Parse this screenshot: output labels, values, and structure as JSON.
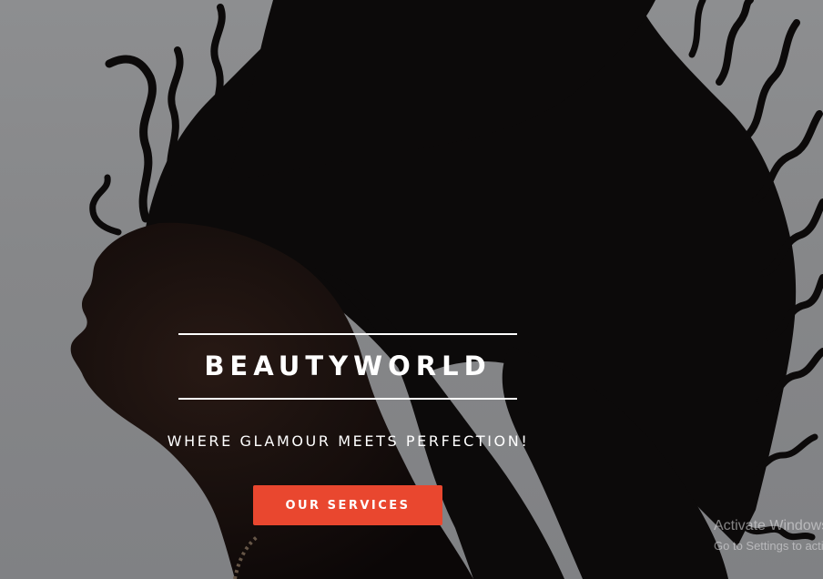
{
  "hero": {
    "brand": "BEAUTYWORLD",
    "tagline": "WHERE GLAMOUR MEETS PERFECTION!",
    "cta_label": "OUR SERVICES"
  },
  "colors": {
    "background": "#8c8d8f",
    "silhouette": "#0e0c0c",
    "accent": "#e9472f",
    "text": "#ffffff"
  },
  "system_watermark": {
    "line1": "Activate Windows",
    "line2": "Go to Settings to activate Windows."
  }
}
